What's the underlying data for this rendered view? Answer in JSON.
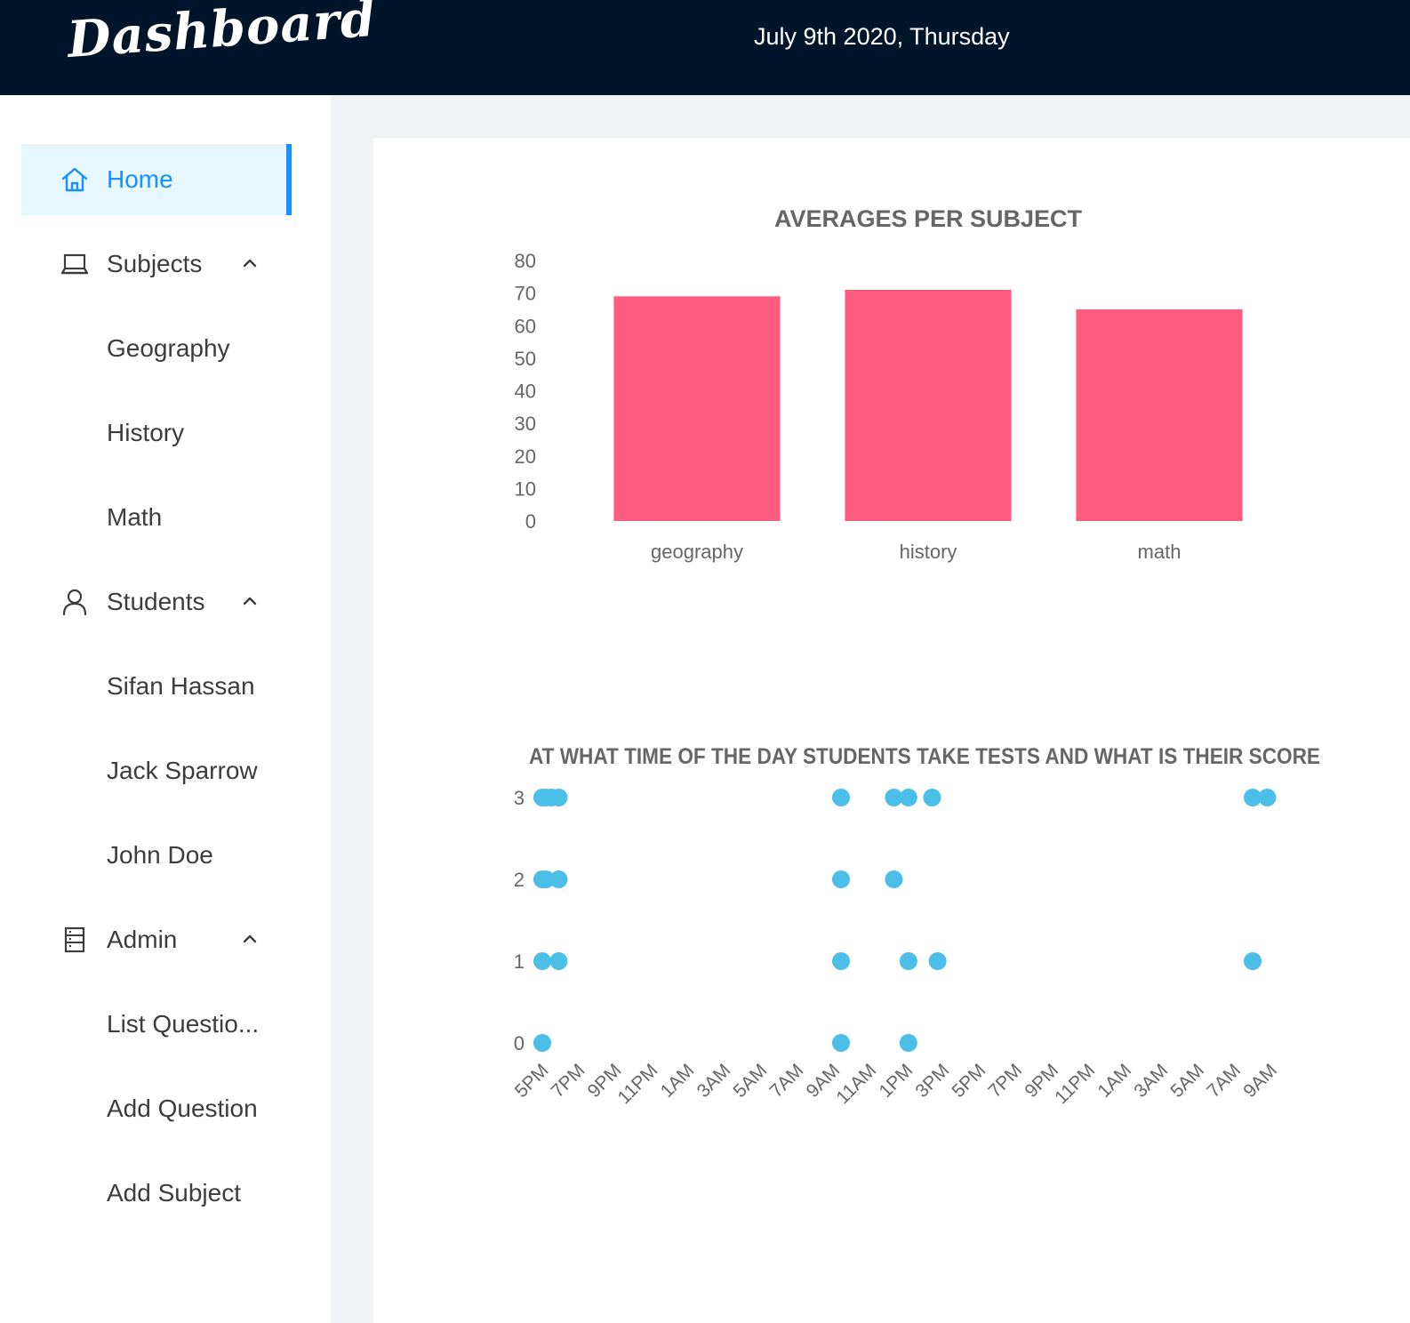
{
  "header": {
    "logo": "Dashboard",
    "date": "July 9th 2020, Thursday"
  },
  "sidebar": {
    "items": [
      {
        "label": "Home",
        "icon": "home-icon",
        "selected": true
      },
      {
        "label": "Subjects",
        "icon": "laptop-icon",
        "expanded": true,
        "children": [
          "Geography",
          "History",
          "Math"
        ]
      },
      {
        "label": "Students",
        "icon": "user-icon",
        "expanded": true,
        "children": [
          "Sifan Hassan",
          "Jack Sparrow",
          "John Doe"
        ]
      },
      {
        "label": "Admin",
        "icon": "table-icon",
        "expanded": true,
        "children": [
          "List Questio...",
          "Add Question",
          "Add Subject"
        ]
      }
    ]
  },
  "colors": {
    "header_bg": "#001529",
    "accent": "#1890ff",
    "selected_bg": "#e6f7ff",
    "bar": "#ff5c80",
    "dot": "#4bbfe8"
  },
  "chart_data": [
    {
      "type": "bar",
      "title": "AVERAGES PER SUBJECT",
      "categories": [
        "geography",
        "history",
        "math"
      ],
      "values": [
        69,
        71,
        65
      ],
      "ylim": [
        0,
        80
      ],
      "yticks": [
        0,
        10,
        20,
        30,
        40,
        50,
        60,
        70,
        80
      ],
      "grid": false,
      "legend": "none"
    },
    {
      "type": "scatter",
      "title": "AT WHAT TIME OF THE DAY STUDENTS TAKE TESTS AND WHAT IS THEIR SCORE",
      "xticks": [
        "5PM",
        "7PM",
        "9PM",
        "11PM",
        "1AM",
        "3AM",
        "5AM",
        "7AM",
        "9AM",
        "11AM",
        "1PM",
        "3PM",
        "5PM",
        "7PM",
        "9PM",
        "11PM",
        "1AM",
        "3AM",
        "5AM",
        "7AM",
        "9AM"
      ],
      "xlim_hours": [
        0,
        41
      ],
      "ylim": [
        0,
        3
      ],
      "yticks": [
        0,
        1,
        2,
        3
      ],
      "grid": false,
      "legend": "none",
      "points": [
        {
          "x": 0.0,
          "y": 3
        },
        {
          "x": 0.2,
          "y": 3
        },
        {
          "x": 0.5,
          "y": 3
        },
        {
          "x": 0.9,
          "y": 3
        },
        {
          "x": 16.4,
          "y": 3
        },
        {
          "x": 19.3,
          "y": 3
        },
        {
          "x": 20.1,
          "y": 3
        },
        {
          "x": 21.4,
          "y": 3
        },
        {
          "x": 39.0,
          "y": 3
        },
        {
          "x": 39.8,
          "y": 3
        },
        {
          "x": 0.0,
          "y": 2
        },
        {
          "x": 0.2,
          "y": 2
        },
        {
          "x": 0.9,
          "y": 2
        },
        {
          "x": 16.4,
          "y": 2
        },
        {
          "x": 19.3,
          "y": 2
        },
        {
          "x": 0.0,
          "y": 1
        },
        {
          "x": 0.9,
          "y": 1
        },
        {
          "x": 16.4,
          "y": 1
        },
        {
          "x": 20.1,
          "y": 1
        },
        {
          "x": 21.7,
          "y": 1
        },
        {
          "x": 39.0,
          "y": 1
        },
        {
          "x": 0.0,
          "y": 0
        },
        {
          "x": 16.4,
          "y": 0
        },
        {
          "x": 20.1,
          "y": 0
        }
      ]
    }
  ]
}
